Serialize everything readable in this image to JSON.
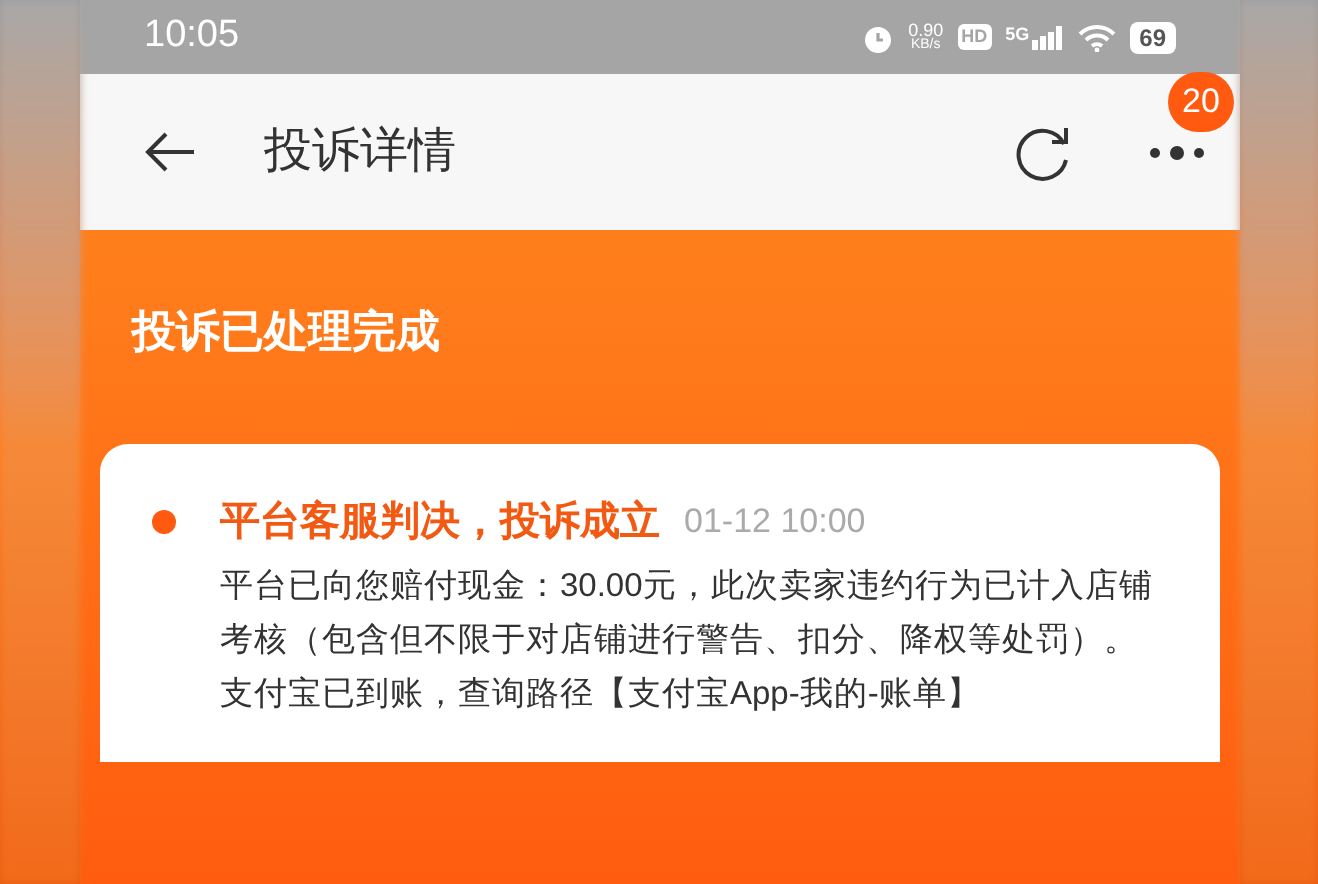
{
  "status_bar": {
    "time": "10:05",
    "speed_value": "0.90",
    "speed_unit": "KB/s",
    "hd_badge": "HD",
    "network": "5G",
    "battery": "69"
  },
  "header": {
    "title": "投诉详情",
    "badge": "20"
  },
  "banner": {
    "title": "投诉已处理完成"
  },
  "timeline": [
    {
      "title": "平台客服判决，投诉成立",
      "time": "01-12 10:00",
      "paragraphs": [
        "平台已向您赔付现金：30.00元，此次卖家违约行为已计入店铺考核（包含但不限于对店铺进行警告、扣分、降权等处罚）。",
        "支付宝已到账，查询路径【支付宝App-我的-账单】"
      ]
    }
  ]
}
